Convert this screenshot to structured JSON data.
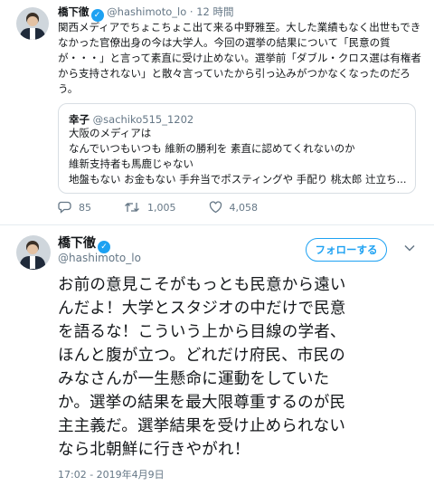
{
  "reply_tweet": {
    "author_name": "橋下徹",
    "handle": "@hashimoto_lo",
    "separator": "·",
    "time_ago": "12 時間",
    "body_lines": [
      "関西メディアでちょこちょこ出て来る中野雅至。大した業績もなく出世もでき",
      "なかった官僚出身の今は大学人。今回の選挙の結果について「民意の質",
      "が・・・」と言って素直に受け止めない。選挙前「ダブル・クロス選は有権者",
      "から支持されない」と散々言っていたから引っ込みがつかなくなったのだろ",
      "う。"
    ],
    "quoted": {
      "author_name": "幸子",
      "handle": "@sachiko515_1202",
      "body_lines": [
        "大阪のメディアは",
        "なんでいつもいつも 維新の勝利を 素直に認めてくれないのか",
        "維新支持者も馬鹿じゃない",
        "地盤もない お金もない 手弁当でポスティングや 手配り 桃太郎 辻立ち..."
      ]
    },
    "actions": {
      "replies": "85",
      "retweets": "1,005",
      "likes": "4,058"
    }
  },
  "main_tweet": {
    "author_name": "橋下徹",
    "handle": "@hashimoto_lo",
    "follow_label": "フォローする",
    "body_lines": [
      "お前の意見こそがもっとも民意から遠い",
      "んだよ！大学とスタジオの中だけで民意",
      "を語るな！こういう上から目線の学者、",
      "ほんと腹が立つ。どれだけ府民、市民の",
      "みなさんが一生懸命に運動をしていた",
      "か。選挙の結果を最大限尊重するのが民",
      "主主義だ。選挙結果を受け止められない",
      "なら北朝鮮に行きやがれ！"
    ],
    "timestamp": "17:02 - 2019年4月9日"
  },
  "colors": {
    "accent": "#1da1f2",
    "muted": "#657786",
    "text": "#14171a",
    "border": "#d8dee3"
  },
  "icons": [
    "verified-icon",
    "reply-icon",
    "retweet-icon",
    "like-icon",
    "chevron-down-icon"
  ]
}
